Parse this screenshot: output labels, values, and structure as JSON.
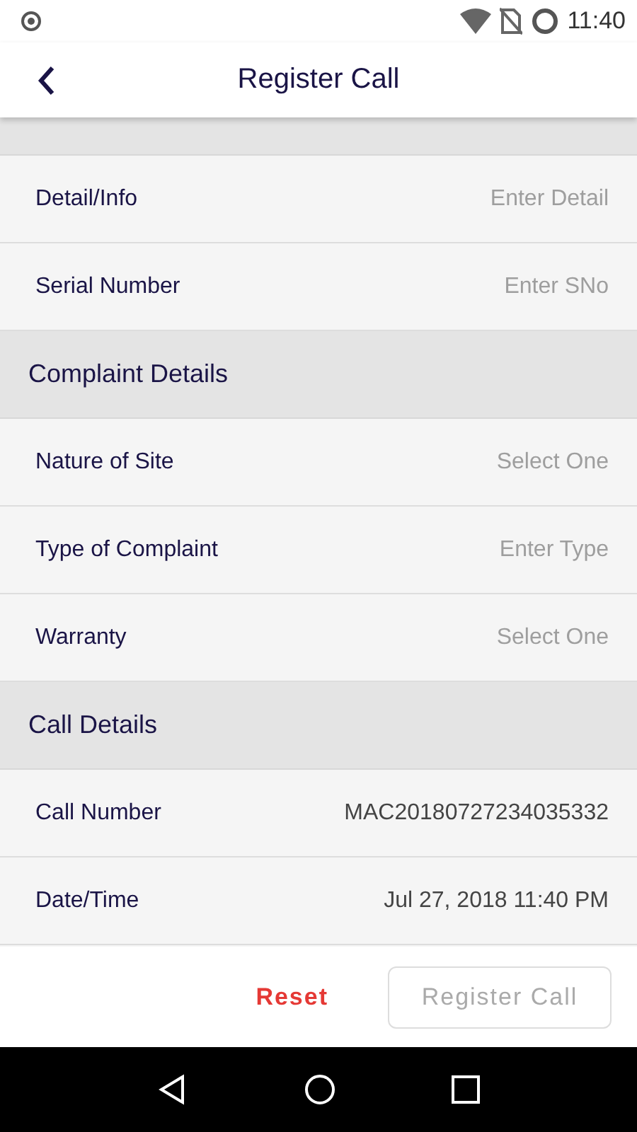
{
  "status_bar": {
    "time": "11:40"
  },
  "app_bar": {
    "title": "Register Call"
  },
  "sections": [
    {
      "rows": [
        {
          "label": "Detail/Info",
          "kind": "input",
          "placeholder": "Enter Detail"
        },
        {
          "label": "Serial Number",
          "kind": "input",
          "placeholder": "Enter SNo"
        }
      ]
    },
    {
      "title": "Complaint Details",
      "rows": [
        {
          "label": "Nature of Site",
          "kind": "select",
          "placeholder": "Select One"
        },
        {
          "label": "Type of Complaint",
          "kind": "input",
          "placeholder": "Enter Type"
        },
        {
          "label": "Warranty",
          "kind": "select",
          "placeholder": "Select One"
        }
      ]
    },
    {
      "title": "Call Details",
      "rows": [
        {
          "label": "Call Number",
          "kind": "value",
          "value": "MAC20180727234035332"
        },
        {
          "label": "Date/Time",
          "kind": "value",
          "value": "Jul 27, 2018 11:40 PM"
        }
      ]
    }
  ],
  "footer": {
    "reset": "Reset",
    "submit": {
      "label": "Register Call",
      "disabled": true
    }
  }
}
